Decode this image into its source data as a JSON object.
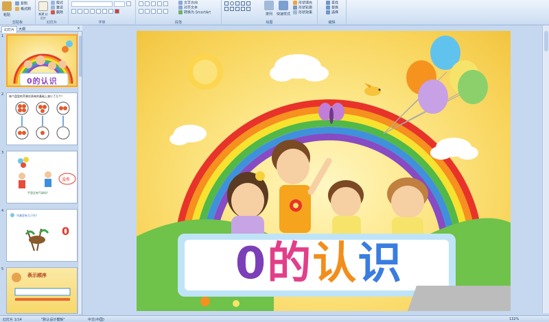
{
  "ribbon": {
    "groups": [
      {
        "name": "clipboard",
        "label": "剪贴板"
      },
      {
        "name": "slides",
        "label": "幻灯片"
      },
      {
        "name": "font",
        "label": "字体"
      },
      {
        "name": "paragraph",
        "label": "段落"
      },
      {
        "name": "drawing",
        "label": "绘图"
      },
      {
        "name": "editing",
        "label": "编辑"
      }
    ],
    "paste": "粘贴",
    "copy": "复制",
    "format_painter": "格式刷",
    "new_slide": "新建\n幻灯片",
    "layout": "版式",
    "reset": "重设",
    "delete": "删除",
    "text_direction": "文字方向",
    "align_text": "对齐文本",
    "convert_smartart": "转换为 SmartArt",
    "arrange": "排列",
    "quick_styles": "快速样式",
    "shape_fill": "形状填充",
    "shape_outline": "形状轮廓",
    "shape_effects": "形状效果",
    "find": "查找",
    "replace": "替换",
    "select": "选择"
  },
  "panel": {
    "tab_slides": "幻灯片",
    "tab_outline": "大纲",
    "close": "×",
    "thumbs": [
      {
        "num": "1",
        "title": "0的认识"
      },
      {
        "num": "2",
        "title": "每个盘里的苹果在原来的基础上减少了几个？"
      },
      {
        "num": "3",
        "title": "没有",
        "caption": "手里还有气球吗？"
      },
      {
        "num": "4",
        "title": "0",
        "caption": "鸟巢里有几只鸟？"
      },
      {
        "num": "5",
        "title": "表示顺序"
      }
    ]
  },
  "slide": {
    "title": "0的认识",
    "colors": {
      "zero": "#7b3fb7",
      "de": "#e23f8a",
      "ren": "#f28e1c",
      "shi": "#3a7de0"
    }
  },
  "status": {
    "slide_count": "幻灯片 1/14",
    "theme": "\"默认设计模板\"",
    "language": "中文(中国)",
    "zoom": "132%"
  }
}
